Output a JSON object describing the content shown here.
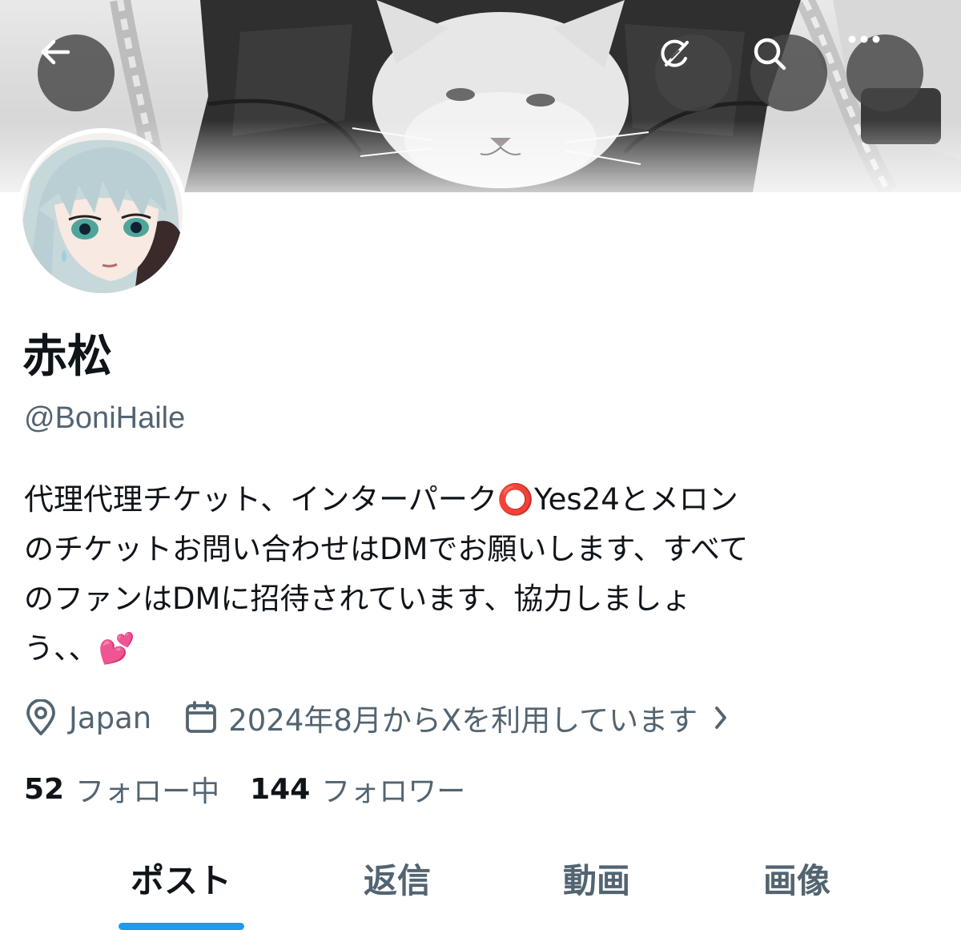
{
  "profile": {
    "display_name": "赤松",
    "handle": "@BoniHaile",
    "bio": "代理代理チケット、インターパーク⭕Yes24とメロン\nのチケットお問い合わせはDMでお願いします、すべて\nのファンはDMに招待されています、協力しましょ\nう、、💕",
    "location": "Japan",
    "joined": "2024年8月からXを利用しています"
  },
  "stats": {
    "following_count": "52",
    "following_label": "フォロー中",
    "followers_count": "144",
    "followers_label": "フォロワー"
  },
  "tabs": {
    "posts": "ポスト",
    "replies": "返信",
    "videos": "動画",
    "images": "画像",
    "active": "ポスト"
  },
  "icons": {
    "back": "back-arrow-icon",
    "grok": "grok-icon",
    "search": "search-icon",
    "more": "more-icon",
    "location": "location-pin-icon",
    "calendar": "calendar-icon",
    "chevron": "chevron-right-icon"
  },
  "colors": {
    "accent": "#1d9bf0",
    "secondary_text": "#536471",
    "primary_text": "#0f1419",
    "icon_button_bg": "#464646"
  }
}
